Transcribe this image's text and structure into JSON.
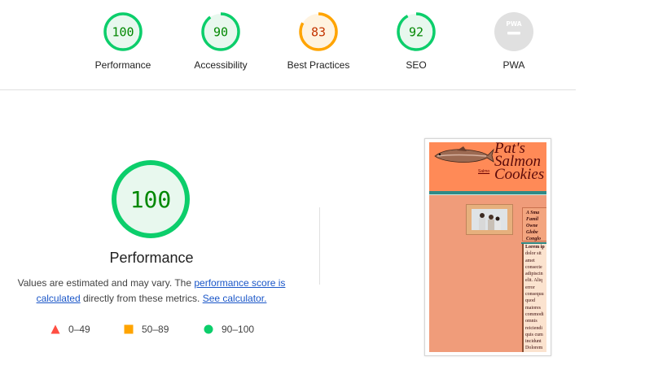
{
  "gauges": [
    {
      "score": "100",
      "label": "Performance",
      "value": 100,
      "color": "#0cce6b",
      "bg": "#e8f8ee",
      "text_color": "#008800"
    },
    {
      "score": "90",
      "label": "Accessibility",
      "value": 90,
      "color": "#0cce6b",
      "bg": "#e8f8ee",
      "text_color": "#008800"
    },
    {
      "score": "83",
      "label": "Best Practices",
      "value": 83,
      "color": "#ffa400",
      "bg": "#fff3e0",
      "text_color": "#c33300"
    },
    {
      "score": "92",
      "label": "SEO",
      "value": 92,
      "color": "#0cce6b",
      "bg": "#e8f8ee",
      "text_color": "#008800"
    },
    {
      "score": "PWA",
      "label": "PWA",
      "value": null,
      "color": "#e0e0e0",
      "bg": "#e0e0e0",
      "text_color": "#ffffff"
    }
  ],
  "main": {
    "score": "100",
    "value": 100,
    "title": "Performance",
    "desc_prefix": "Values are estimated and may vary. The ",
    "desc_link": "performance score is calculated",
    "desc_middle": " directly from these metrics. ",
    "desc_link2": "See calculator."
  },
  "legend": [
    {
      "range": "0–49",
      "shape": "triangle-icon",
      "color": "#ff4e42"
    },
    {
      "range": "50–89",
      "shape": "square-icon",
      "color": "#ffa400"
    },
    {
      "range": "90–100",
      "shape": "circle-icon",
      "color": "#0cce6b"
    }
  ],
  "thumbnail": {
    "title_lines": [
      "Pat's",
      "Salmon",
      "Cookies"
    ],
    "link_text": "Salmo",
    "aside_lines": [
      "A Sma",
      "Famil",
      "Owne",
      "Globe",
      "Conglo"
    ],
    "body_lines": [
      "Lorem ip",
      "dolor sit",
      "amet",
      "consecte",
      "adipiscin",
      "elit. Aliq",
      "error",
      "consequu",
      "quod",
      "maiores",
      "commodi",
      "omnis",
      "reiciendi",
      "quis cum",
      "incidunt",
      "Dolorem"
    ]
  }
}
